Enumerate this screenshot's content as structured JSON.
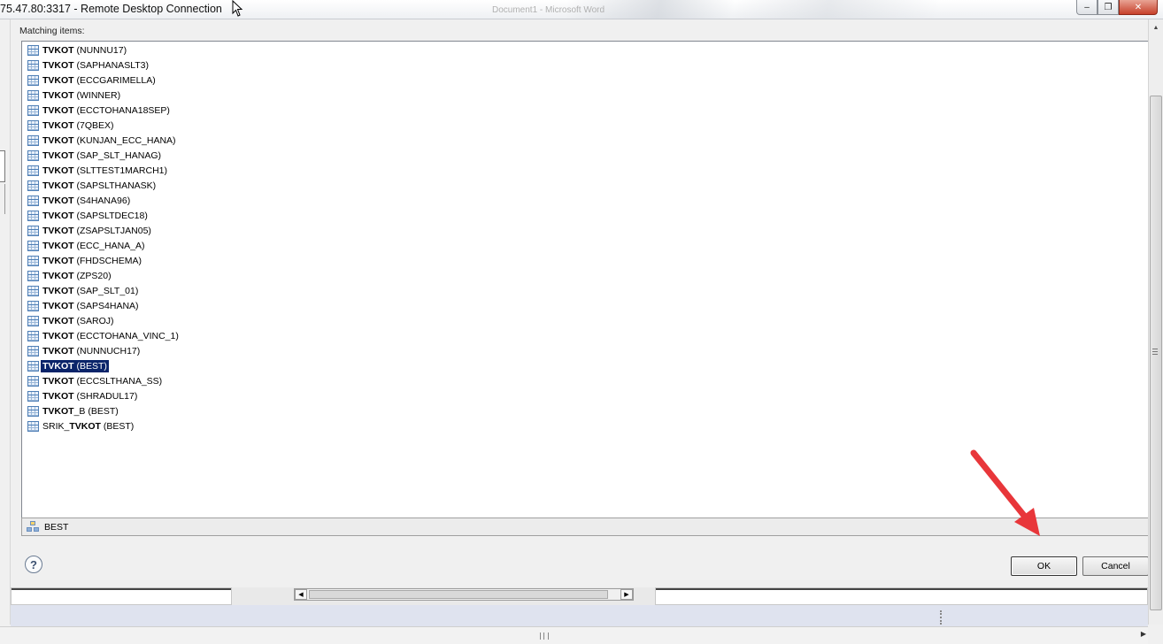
{
  "window": {
    "title": "75.47.80:3317 - Remote Desktop Connection",
    "background_app_title": "Document1 - Microsoft Word",
    "controls": {
      "minimize": "–",
      "restore": "❐",
      "close": "✕"
    }
  },
  "dialog": {
    "matching_label": "Matching items:",
    "items": [
      {
        "name": "TVKOT",
        "schema": " (NUNNU17)"
      },
      {
        "name": "TVKOT",
        "schema": " (SAPHANASLT3)"
      },
      {
        "name": "TVKOT",
        "schema": " (ECCGARIMELLA)"
      },
      {
        "name": "TVKOT",
        "schema": " (WINNER)"
      },
      {
        "name": "TVKOT",
        "schema": " (ECCTOHANA18SEP)"
      },
      {
        "name": "TVKOT",
        "schema": " (7QBEX)"
      },
      {
        "name": "TVKOT",
        "schema": " (KUNJAN_ECC_HANA)"
      },
      {
        "name": "TVKOT",
        "schema": " (SAP_SLT_HANAG)"
      },
      {
        "name": "TVKOT",
        "schema": " (SLTTEST1MARCH1)"
      },
      {
        "name": "TVKOT",
        "schema": " (SAPSLTHANASK)"
      },
      {
        "name": "TVKOT",
        "schema": " (S4HANA96)"
      },
      {
        "name": "TVKOT",
        "schema": " (SAPSLTDEC18)"
      },
      {
        "name": "TVKOT",
        "schema": " (ZSAPSLTJAN05)"
      },
      {
        "name": "TVKOT",
        "schema": " (ECC_HANA_A)"
      },
      {
        "name": "TVKOT",
        "schema": " (FHDSCHEMA)"
      },
      {
        "name": "TVKOT",
        "schema": " (ZPS20)"
      },
      {
        "name": "TVKOT",
        "schema": " (SAP_SLT_01)"
      },
      {
        "name": "TVKOT",
        "schema": " (SAPS4HANA)"
      },
      {
        "name": "TVKOT",
        "schema": " (SAROJ)"
      },
      {
        "name": "TVKOT",
        "schema": " (ECCTOHANA_VINC_1)"
      },
      {
        "name": "TVKOT",
        "schema": " (NUNNUCH17)"
      },
      {
        "name": "TVKOT",
        "schema": " (BEST)",
        "selected": true
      },
      {
        "name": "TVKOT",
        "schema": " (ECCSLTHANA_SS)"
      },
      {
        "name": "TVKOT",
        "schema": " (SHRADUL17)"
      },
      {
        "name": "TVKOT",
        "schema": "_B (BEST)"
      },
      {
        "prefix": "SRIK_",
        "name": "TVKOT",
        "schema": " (BEST)"
      }
    ],
    "status_schema": "BEST",
    "help_label": "?",
    "ok_label": "OK",
    "cancel_label": "Cancel"
  },
  "colors": {
    "selection": "#0a246a",
    "annotation_arrow": "#e8363a"
  }
}
